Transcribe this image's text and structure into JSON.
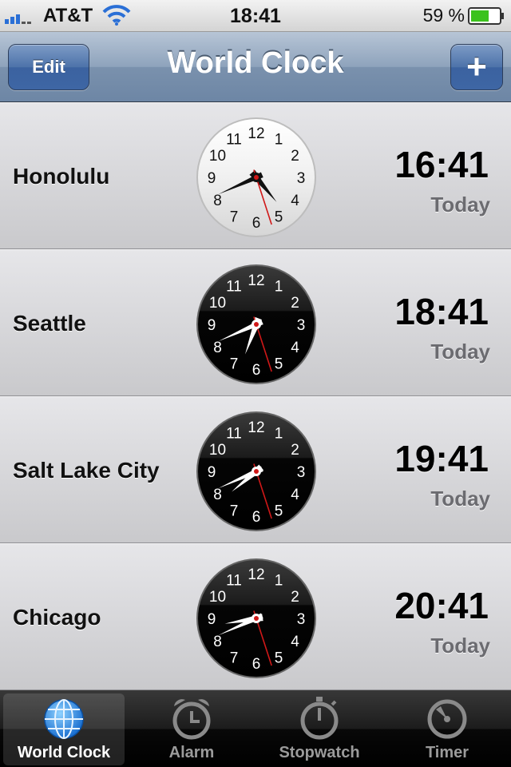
{
  "status_bar": {
    "carrier": "AT&T",
    "time": "18:41",
    "battery_percent": "59 %",
    "icons": [
      "signal-icon",
      "wifi-icon",
      "battery-icon"
    ]
  },
  "nav": {
    "title": "World Clock",
    "edit_label": "Edit",
    "add_label": "+"
  },
  "clocks": [
    {
      "city": "Honolulu",
      "time": "16:41",
      "day": "Today",
      "face": "light"
    },
    {
      "city": "Seattle",
      "time": "18:41",
      "day": "Today",
      "face": "dark"
    },
    {
      "city": "Salt Lake City",
      "time": "19:41",
      "day": "Today",
      "face": "dark"
    },
    {
      "city": "Chicago",
      "time": "20:41",
      "day": "Today",
      "face": "dark"
    }
  ],
  "clock_numbers": [
    "12",
    "1",
    "2",
    "3",
    "4",
    "5",
    "6",
    "7",
    "8",
    "9",
    "10",
    "11"
  ],
  "tabs": [
    {
      "label": "World Clock",
      "icon": "globe-icon",
      "active": true
    },
    {
      "label": "Alarm",
      "icon": "alarm-clock-icon",
      "active": false
    },
    {
      "label": "Stopwatch",
      "icon": "stopwatch-icon",
      "active": false
    },
    {
      "label": "Timer",
      "icon": "timer-icon",
      "active": false
    }
  ],
  "colors": {
    "nav_blue": "#6d86a5",
    "button_blue": "#3e66a4",
    "second_hand": "#d01818",
    "battery_green": "#3bc21d"
  }
}
